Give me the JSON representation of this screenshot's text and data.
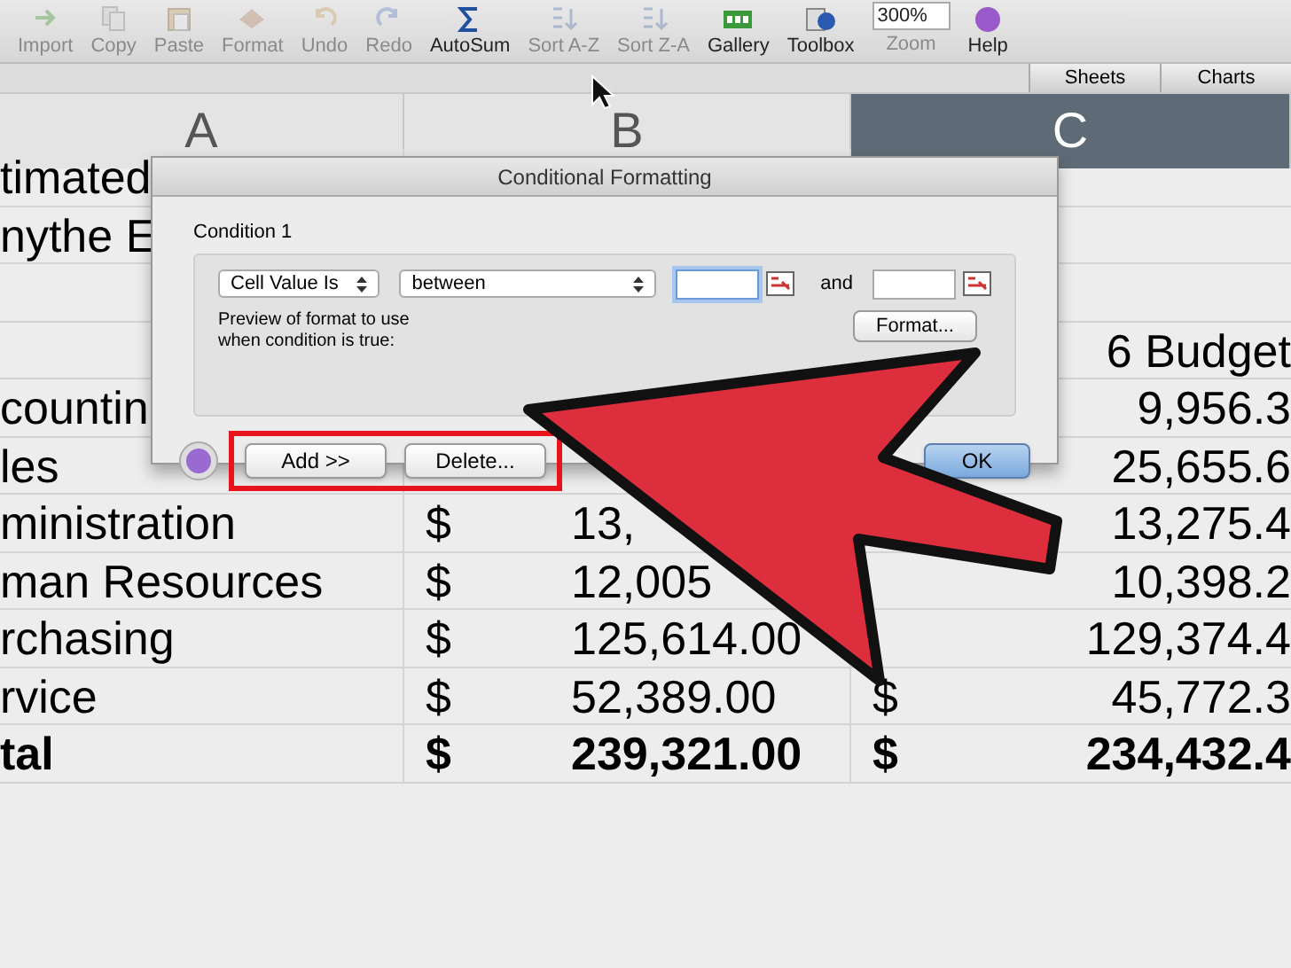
{
  "toolbar": {
    "items": [
      {
        "kind": "button",
        "label": "Import",
        "disabled": true
      },
      {
        "kind": "button",
        "label": "Copy",
        "disabled": true
      },
      {
        "kind": "button",
        "label": "Paste",
        "disabled": true
      },
      {
        "kind": "button",
        "label": "Format",
        "disabled": true
      },
      {
        "kind": "button",
        "label": "Undo",
        "disabled": true
      },
      {
        "kind": "button",
        "label": "Redo",
        "disabled": true
      },
      {
        "kind": "button",
        "label": "AutoSum",
        "disabled": false
      },
      {
        "kind": "button",
        "label": "Sort A-Z",
        "disabled": true
      },
      {
        "kind": "button",
        "label": "Sort Z-A",
        "disabled": true
      },
      {
        "kind": "button",
        "label": "Gallery",
        "disabled": false
      },
      {
        "kind": "button",
        "label": "Toolbox",
        "disabled": false
      },
      {
        "kind": "zoom",
        "label": "Zoom",
        "value": "300%",
        "disabled": true
      },
      {
        "kind": "button",
        "label": "Help",
        "disabled": false
      }
    ]
  },
  "ribbon_tabs": [
    "Sheets",
    "Charts"
  ],
  "columns": [
    {
      "label": "A",
      "selected": false
    },
    {
      "label": "B",
      "selected": false
    },
    {
      "label": "C",
      "selected": true
    }
  ],
  "rows": [
    {
      "bold": false,
      "cells": {
        "a": "timated"
      }
    },
    {
      "bold": false,
      "cells": {
        "a": "nythe E"
      }
    },
    {
      "cells": {}
    },
    {
      "bold": false,
      "cells": {
        "c_value": "6 Budget"
      }
    },
    {
      "bold": false,
      "cells": {
        "a": "countin",
        "c_value": "9,956.3"
      }
    },
    {
      "bold": false,
      "cells": {
        "a": "les",
        "c_value": "25,655.6"
      }
    },
    {
      "bold": false,
      "cells": {
        "a": "ministration",
        "b_sign": "$",
        "b_value": "13,",
        "c_value": "13,275.4"
      }
    },
    {
      "bold": false,
      "cells": {
        "a": "man Resources",
        "b_sign": "$",
        "b_value": "12,005",
        "c_value": "10,398.2"
      }
    },
    {
      "bold": false,
      "cells": {
        "a": "rchasing",
        "b_sign": "$",
        "b_value": "125,614.00",
        "c_value": "129,374.4"
      }
    },
    {
      "bold": false,
      "cells": {
        "a": "rvice",
        "b_sign": "$",
        "b_value": "52,389.00",
        "c_sign": "$",
        "c_value": "45,772.3"
      }
    },
    {
      "bold": true,
      "cells": {
        "a": "tal",
        "b_sign": "$",
        "b_value": "239,321.00",
        "c_sign": "$",
        "c_value": "234,432.4"
      }
    }
  ],
  "dialog": {
    "title": "Conditional Formatting",
    "condition_label": "Condition 1",
    "operand_select": "Cell Value Is",
    "operator_select": "between",
    "first_value": {
      "focused": true
    },
    "and_label": "and",
    "second_value": {
      "focused": false
    },
    "preview_label": "Preview of format to use\nwhen condition is true:",
    "format_button": "Format...",
    "buttons": [
      {
        "label": "Add >>",
        "highlighted": true,
        "default": false
      },
      {
        "label": "Delete...",
        "highlighted": true,
        "default": false
      },
      {
        "label": "OK",
        "highlighted": false,
        "default": true
      }
    ]
  }
}
